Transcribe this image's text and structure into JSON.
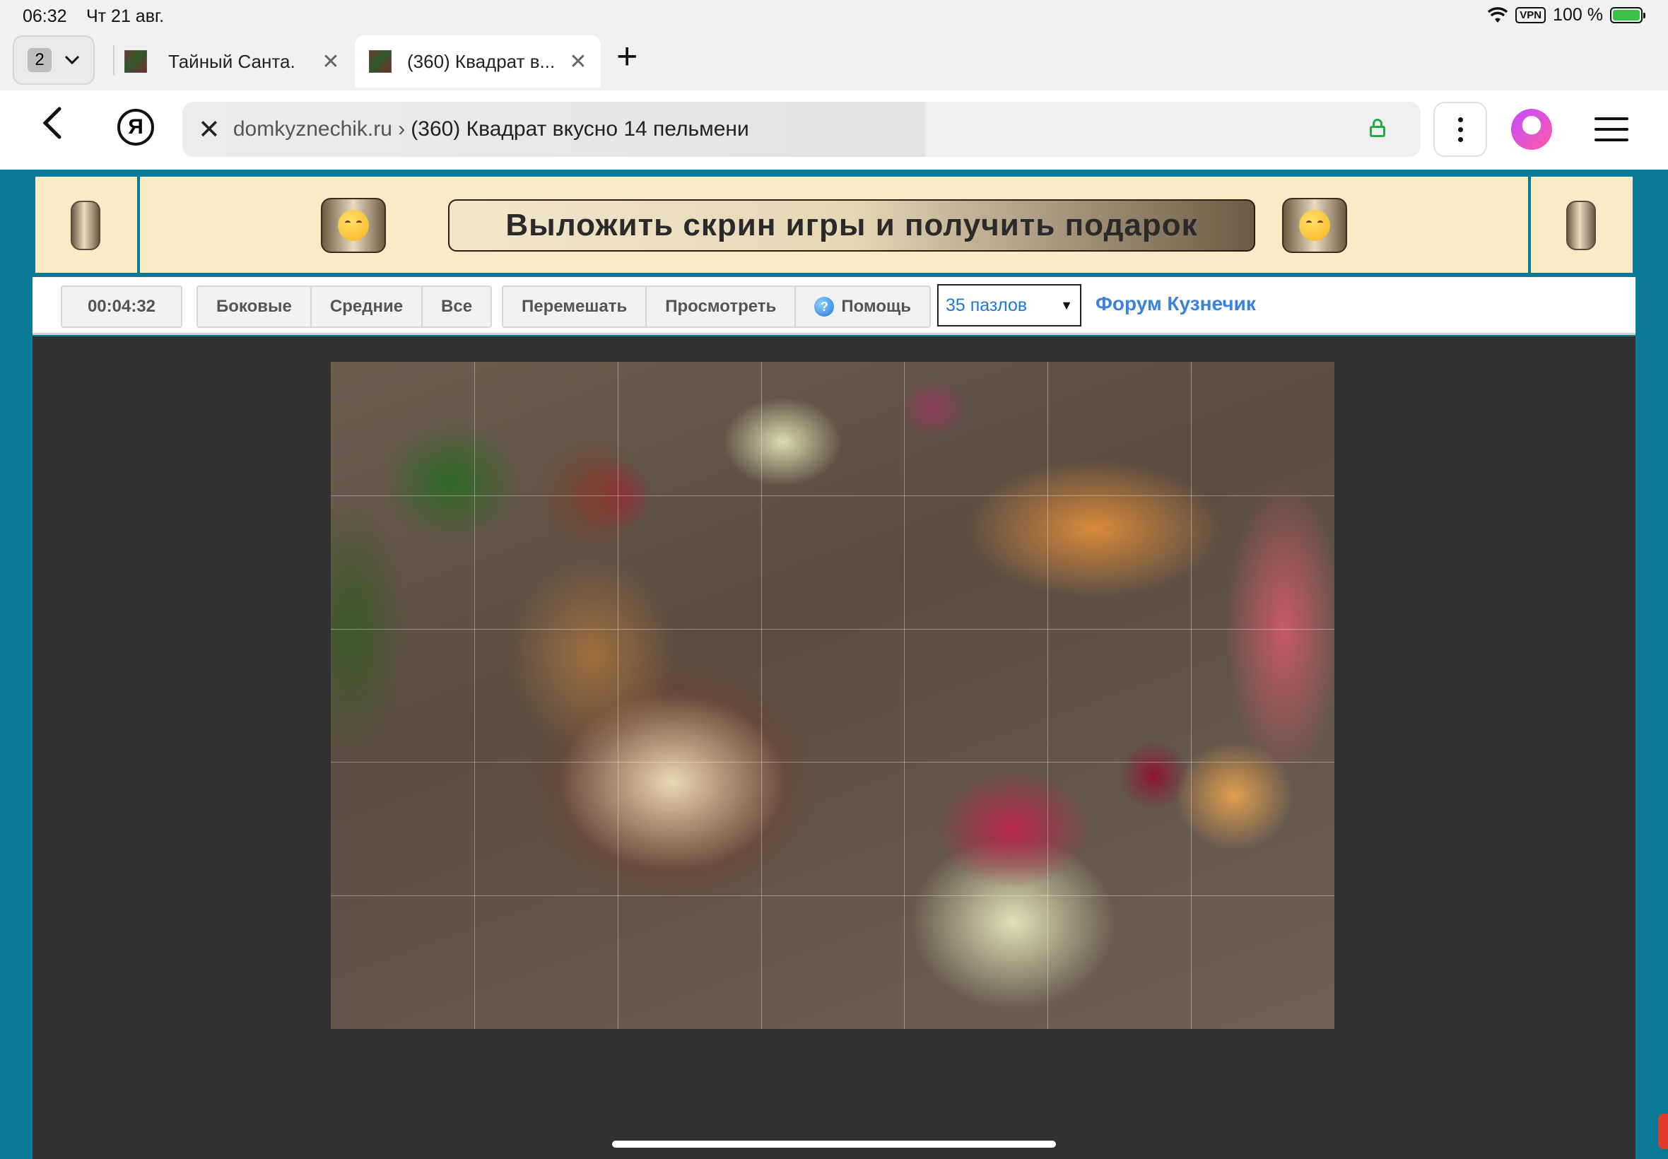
{
  "status_bar": {
    "time": "06:32",
    "date": "Чт 21 авг.",
    "vpn": "VPN",
    "battery": "100 %"
  },
  "tabs": {
    "count": "2",
    "items": [
      {
        "title": "Тайный Санта.",
        "active": false
      },
      {
        "title": "(360) Квадрат в...",
        "active": true
      }
    ]
  },
  "address_bar": {
    "domain": "domkyznechik.ru ›",
    "page_title": "(360) Квадрат вкусно 14 пельмени"
  },
  "banner": {
    "text": "Выложить скрин игры и получить подарок"
  },
  "toolbar": {
    "timer": "00:04:32",
    "filter_buttons": [
      "Боковые",
      "Средние",
      "Все"
    ],
    "action_buttons": [
      "Перемешать",
      "Просмотреть"
    ],
    "help": "Помощь",
    "pieces_select": "35 пазлов",
    "forum_link": "Форум Кузнечик"
  },
  "puzzle": {
    "columns": 7,
    "rows": 5
  },
  "colors": {
    "page_bg": "#0b7a96",
    "banner_bg": "#f8ebc5",
    "game_bg": "#313131",
    "link": "#3b82e0"
  }
}
